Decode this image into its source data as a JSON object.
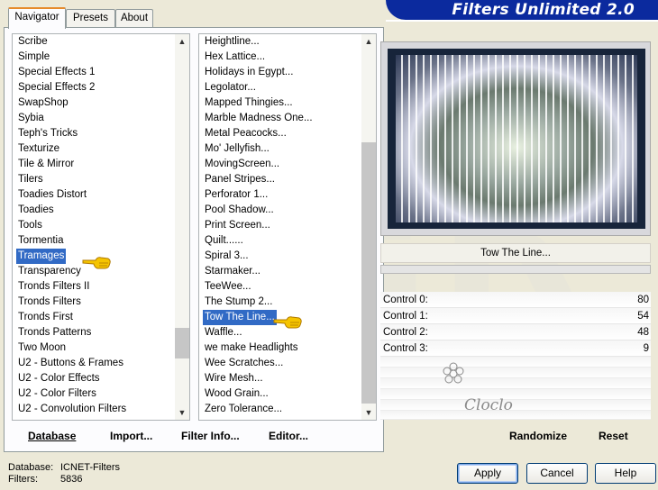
{
  "banner": {
    "title": "Filters Unlimited 2.0"
  },
  "tabs": [
    {
      "label": "Navigator",
      "active": true
    },
    {
      "label": "Presets",
      "active": false
    },
    {
      "label": "About",
      "active": false
    }
  ],
  "categories": {
    "items": [
      "Scribe",
      "Simple",
      "Special Effects 1",
      "Special Effects 2",
      "SwapShop",
      "Sybia",
      "Teph's Tricks",
      "Texturize",
      "Tile & Mirror",
      "Tilers",
      "Toadies Distort",
      "Toadies",
      "Tools",
      "Tormentia",
      "Tramages",
      "Transparency",
      "Tronds Filters II",
      "Tronds Filters",
      "Tronds First",
      "Tronds Patterns",
      "Two Moon",
      "U2 - Buttons & Frames",
      "U2 - Color Effects",
      "U2 - Color Filters",
      "U2 - Convolution Filters"
    ],
    "selected": "Tramages"
  },
  "filters": {
    "items": [
      "Heightline...",
      "Hex Lattice...",
      "Holidays in Egypt...",
      "Legolator...",
      "Mapped Thingies...",
      "Marble Madness One...",
      "Metal Peacocks...",
      "Mo' Jellyfish...",
      "MovingScreen...",
      "Panel Stripes...",
      "Perforator 1...",
      "Pool Shadow...",
      "Print Screen...",
      "Quilt......",
      "Spiral 3...",
      "Starmaker...",
      "TeeWee...",
      "The Stump 2...",
      "Tow The Line...",
      "Waffle...",
      "we make Headlights",
      "Wee Scratches...",
      "Wire Mesh...",
      "Wood Grain...",
      "Zero Tolerance..."
    ],
    "selected": "Tow The Line..."
  },
  "preview": {
    "filter_name": "Tow The Line...",
    "signature": "Cloclo"
  },
  "controls": [
    {
      "label": "Control 0:",
      "value": "80"
    },
    {
      "label": "Control 1:",
      "value": "54"
    },
    {
      "label": "Control 2:",
      "value": "48"
    },
    {
      "label": "Control 3:",
      "value": "9"
    }
  ],
  "toolbar": {
    "database": "Database",
    "import": "Import...",
    "filter_info": "Filter Info...",
    "editor": "Editor...",
    "randomize": "Randomize",
    "reset": "Reset"
  },
  "status": {
    "database_label": "Database:",
    "database_value": "ICNET-Filters",
    "filters_label": "Filters:",
    "filters_value": "5836"
  },
  "buttons": {
    "apply": "Apply",
    "cancel": "Cancel",
    "help": "Help"
  },
  "colors": {
    "banner": "#0b2a9e",
    "selection": "#316ac5",
    "tab_accent": "#e68b2c"
  },
  "icons": {
    "pointer": "pointing-hand-icon",
    "scroll_up": "arrow-up-icon",
    "scroll_down": "arrow-down-icon"
  }
}
